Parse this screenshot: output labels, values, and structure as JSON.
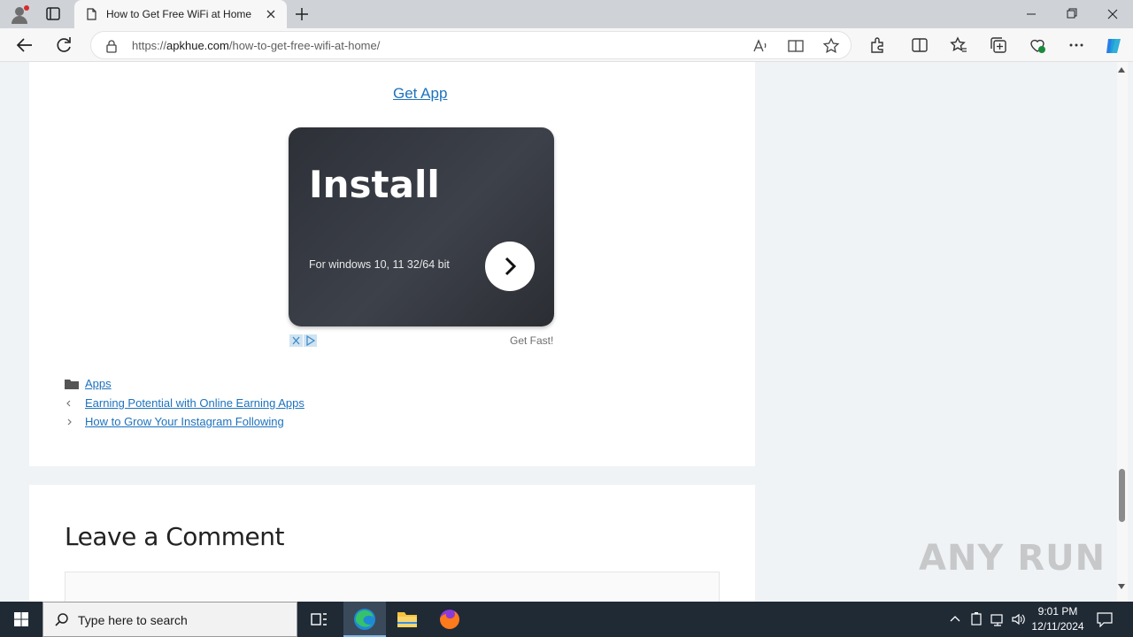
{
  "browser": {
    "tab_title": "How to Get Free WiFi at Home",
    "url_prefix": "https://",
    "url_host": "apkhue.com",
    "url_path": "/how-to-get-free-wifi-at-home/"
  },
  "article": {
    "get_app_link": "Get App",
    "ad": {
      "headline": "Install",
      "subtext": "For windows 10, 11 32/64 bit",
      "footer": "Get Fast!"
    },
    "category_link": "Apps",
    "prev_post": "Earning Potential with Online Earning Apps",
    "next_post": "How to Grow Your Instagram Following"
  },
  "comments": {
    "heading": "Leave a Comment"
  },
  "watermark": "ANY RUN",
  "taskbar": {
    "search_placeholder": "Type here to search",
    "time": "9:01 PM",
    "date": "12/11/2024"
  }
}
